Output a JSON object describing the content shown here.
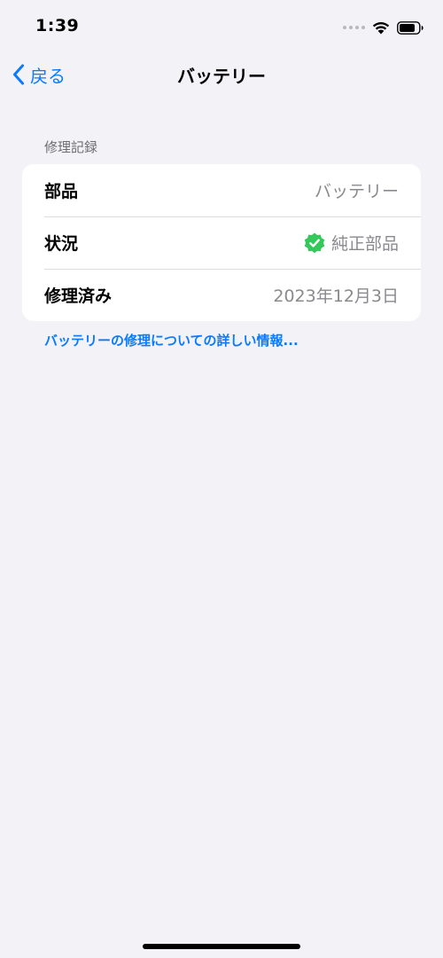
{
  "status_bar": {
    "time": "1:39",
    "icons": [
      "signal-dots-icon",
      "wifi-icon",
      "battery-icon"
    ]
  },
  "nav": {
    "back_label": "戻る",
    "title": "バッテリー"
  },
  "section": {
    "header": "修理記録",
    "rows": [
      {
        "label": "部品",
        "value": "バッテリー"
      },
      {
        "label": "状況",
        "value": "純正部品",
        "icon": "verified-badge-icon"
      },
      {
        "label": "修理済み",
        "value": "2023年12月3日"
      }
    ]
  },
  "info_link": "バッテリーの修理についての詳しい情報...",
  "colors": {
    "accent": "#0a7aff",
    "background": "#f2f2f7",
    "verified_green": "#34c759",
    "secondary_text": "#8a8a8e"
  }
}
